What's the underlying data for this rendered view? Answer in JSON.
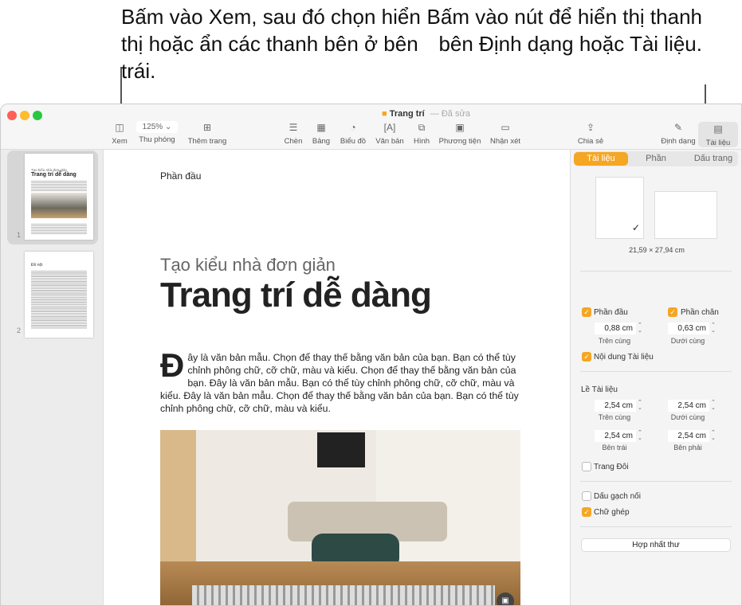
{
  "callouts": {
    "left": "Bấm vào Xem, sau đó chọn hiển thị hoặc ẩn các thanh bên ở bên trái.",
    "right": "Bấm vào nút để hiển thị thanh bên Định dạng hoặc Tài liệu."
  },
  "window": {
    "title": "Trang trí",
    "status": "Đã sửa"
  },
  "toolbar": {
    "view": "Xem",
    "zoom_value": "125%",
    "zoom": "Thu phóng",
    "add_page": "Thêm trang",
    "insert": "Chèn",
    "table": "Bảng",
    "chart": "Biểu đồ",
    "text": "Văn bản",
    "shape": "Hình",
    "media": "Phương tiện",
    "comment": "Nhận xét",
    "share": "Chia sẻ",
    "format": "Định dạng",
    "document": "Tài liệu"
  },
  "thumbnails": {
    "pages": [
      "1",
      "2"
    ],
    "p1_subtitle": "Tạo kiểu nhà đơn giản",
    "p1_title": "Trang trí dễ dàng",
    "p2_heading": "Đồ nội"
  },
  "document": {
    "header": "Phần đầu",
    "subtitle": "Tạo kiểu nhà đơn giản",
    "title": "Trang trí dễ dàng",
    "dropcap": "Đ",
    "body": "ây là văn bản mẫu. Chọn để thay thế bằng văn bản của bạn. Bạn có thể tùy chỉnh phông chữ, cỡ chữ, màu và kiểu. Chọn để thay thế bằng văn bản của bạn. Đây là văn bản mẫu. Bạn có thể tùy chỉnh phông chữ, cỡ chữ, màu và kiểu. Đây là văn bản mẫu. Chọn để thay thế bằng văn bản của bạn. Bạn có thể tùy chỉnh phông chữ, cỡ chữ, màu và kiểu."
  },
  "inspector": {
    "tabs": [
      "Tài liệu",
      "Phần",
      "Dấu trang"
    ],
    "paper_size": "21,59 × 27,94 cm",
    "header_label": "Phần đầu",
    "footer_label": "Phần chân",
    "header_value": "0,88 cm",
    "footer_value": "0,63 cm",
    "top": "Trên cùng",
    "bottom": "Dưới cùng",
    "body_label": "Nội dung Tài liệu",
    "margins_title": "Lề Tài liệu",
    "m_top": "2,54 cm",
    "m_bottom": "2,54 cm",
    "m_left": "2,54 cm",
    "m_right": "2,54 cm",
    "left": "Bên trái",
    "right": "Bên phải",
    "facing": "Trang Đôi",
    "hyphen": "Dấu gạch nối",
    "ligatures": "Chữ ghép",
    "mail_merge": "Hợp nhất thư"
  },
  "colors": {
    "accent": "#f5a623"
  }
}
